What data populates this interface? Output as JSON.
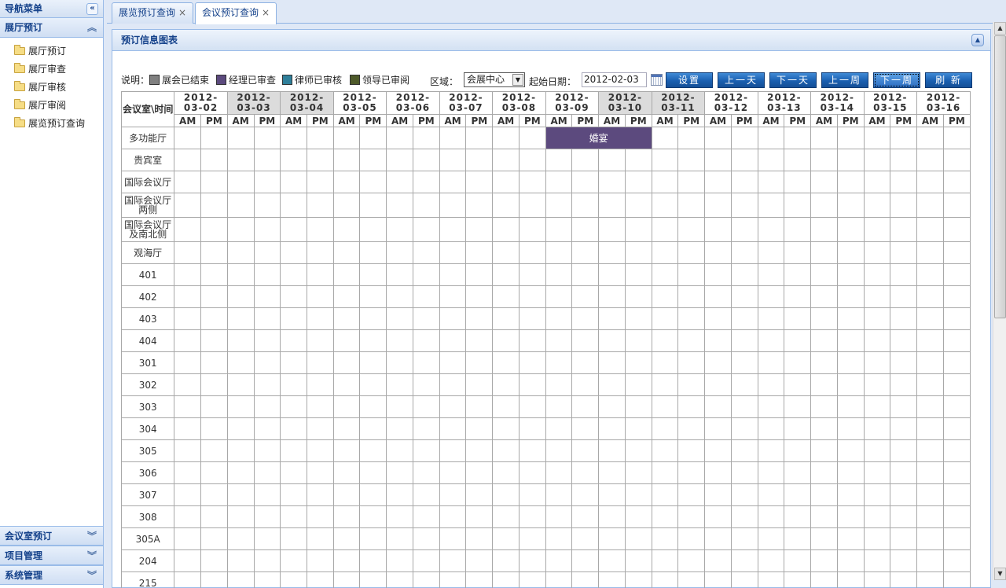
{
  "nav": {
    "title": "导航菜单",
    "collapse_glyph": "«",
    "panels": [
      {
        "label": "展厅预订",
        "expanded": true,
        "icon": "chevron-up-icon",
        "items": [
          "展厅预订",
          "展厅审查",
          "展厅审核",
          "展厅审阅",
          "展览预订查询"
        ]
      },
      {
        "label": "会议室预订",
        "expanded": false,
        "icon": "chevron-down-icon"
      },
      {
        "label": "项目管理",
        "expanded": false,
        "icon": "chevron-down-icon"
      },
      {
        "label": "系统管理",
        "expanded": false,
        "icon": "chevron-down-icon"
      }
    ]
  },
  "tabs": [
    {
      "label": "展览预订查询",
      "active": false
    },
    {
      "label": "会议预订查询",
      "active": true
    }
  ],
  "panel": {
    "title": "预订信息图表"
  },
  "legend": {
    "label": "说明：",
    "items": [
      {
        "label": "展会已结束",
        "color": "#808080"
      },
      {
        "label": "经理已审查",
        "color": "#5c4a7e"
      },
      {
        "label": "律师已审核",
        "color": "#2f7f9a"
      },
      {
        "label": "领导已审阅",
        "color": "#4e5a2a"
      }
    ]
  },
  "filters": {
    "region_label": "区域：",
    "region_value": "会展中心",
    "date_label": "起始日期：",
    "date_value": "2012-02-03"
  },
  "buttons": [
    {
      "name": "set-button",
      "label": "设置",
      "active": false
    },
    {
      "name": "prev-day-button",
      "label": "上一天",
      "active": false
    },
    {
      "name": "next-day-button",
      "label": "下一天",
      "active": false
    },
    {
      "name": "prev-week-button",
      "label": "上一周",
      "active": false
    },
    {
      "name": "next-week-button",
      "label": "下一周",
      "active": true
    },
    {
      "name": "refresh-button",
      "label": "刷 新",
      "active": false
    }
  ],
  "grid": {
    "corner": "会议室\\时间",
    "am": "AM",
    "pm": "PM",
    "dates": [
      {
        "label": "2012-03-02",
        "weekend": false
      },
      {
        "label": "2012-03-03",
        "weekend": true
      },
      {
        "label": "2012-03-04",
        "weekend": true
      },
      {
        "label": "2012-03-05",
        "weekend": false
      },
      {
        "label": "2012-03-06",
        "weekend": false
      },
      {
        "label": "2012-03-07",
        "weekend": false
      },
      {
        "label": "2012-03-08",
        "weekend": false
      },
      {
        "label": "2012-03-09",
        "weekend": false
      },
      {
        "label": "2012-03-10",
        "weekend": true
      },
      {
        "label": "2012-03-11",
        "weekend": true
      },
      {
        "label": "2012-03-12",
        "weekend": false
      },
      {
        "label": "2012-03-13",
        "weekend": false
      },
      {
        "label": "2012-03-14",
        "weekend": false
      },
      {
        "label": "2012-03-15",
        "weekend": false
      },
      {
        "label": "2012-03-16",
        "weekend": false
      }
    ],
    "rooms": [
      {
        "name": "多功能厅",
        "tall": false
      },
      {
        "name": "贵宾室",
        "tall": false
      },
      {
        "name": "国际会议厅",
        "tall": false
      },
      {
        "name": "国际会议厅两侧",
        "tall": true
      },
      {
        "name": "国际会议厅及南北侧",
        "tall": true
      },
      {
        "name": "观海厅",
        "tall": false
      },
      {
        "name": "401",
        "tall": false
      },
      {
        "name": "402",
        "tall": false
      },
      {
        "name": "403",
        "tall": false
      },
      {
        "name": "404",
        "tall": false
      },
      {
        "name": "301",
        "tall": false
      },
      {
        "name": "302",
        "tall": false
      },
      {
        "name": "303",
        "tall": false
      },
      {
        "name": "304",
        "tall": false
      },
      {
        "name": "305",
        "tall": false
      },
      {
        "name": "306",
        "tall": false
      },
      {
        "name": "307",
        "tall": false
      },
      {
        "name": "308",
        "tall": false
      },
      {
        "name": "305A",
        "tall": false
      },
      {
        "name": "204",
        "tall": false
      },
      {
        "name": "215",
        "tall": false
      }
    ],
    "bookings": [
      {
        "room": "多功能厅",
        "start_date": "2012-03-09",
        "start_half": "AM",
        "end_date": "2012-03-10",
        "end_half": "PM",
        "label": "婚宴",
        "status": "经理已审查",
        "color": "#5c4a7e"
      }
    ]
  }
}
